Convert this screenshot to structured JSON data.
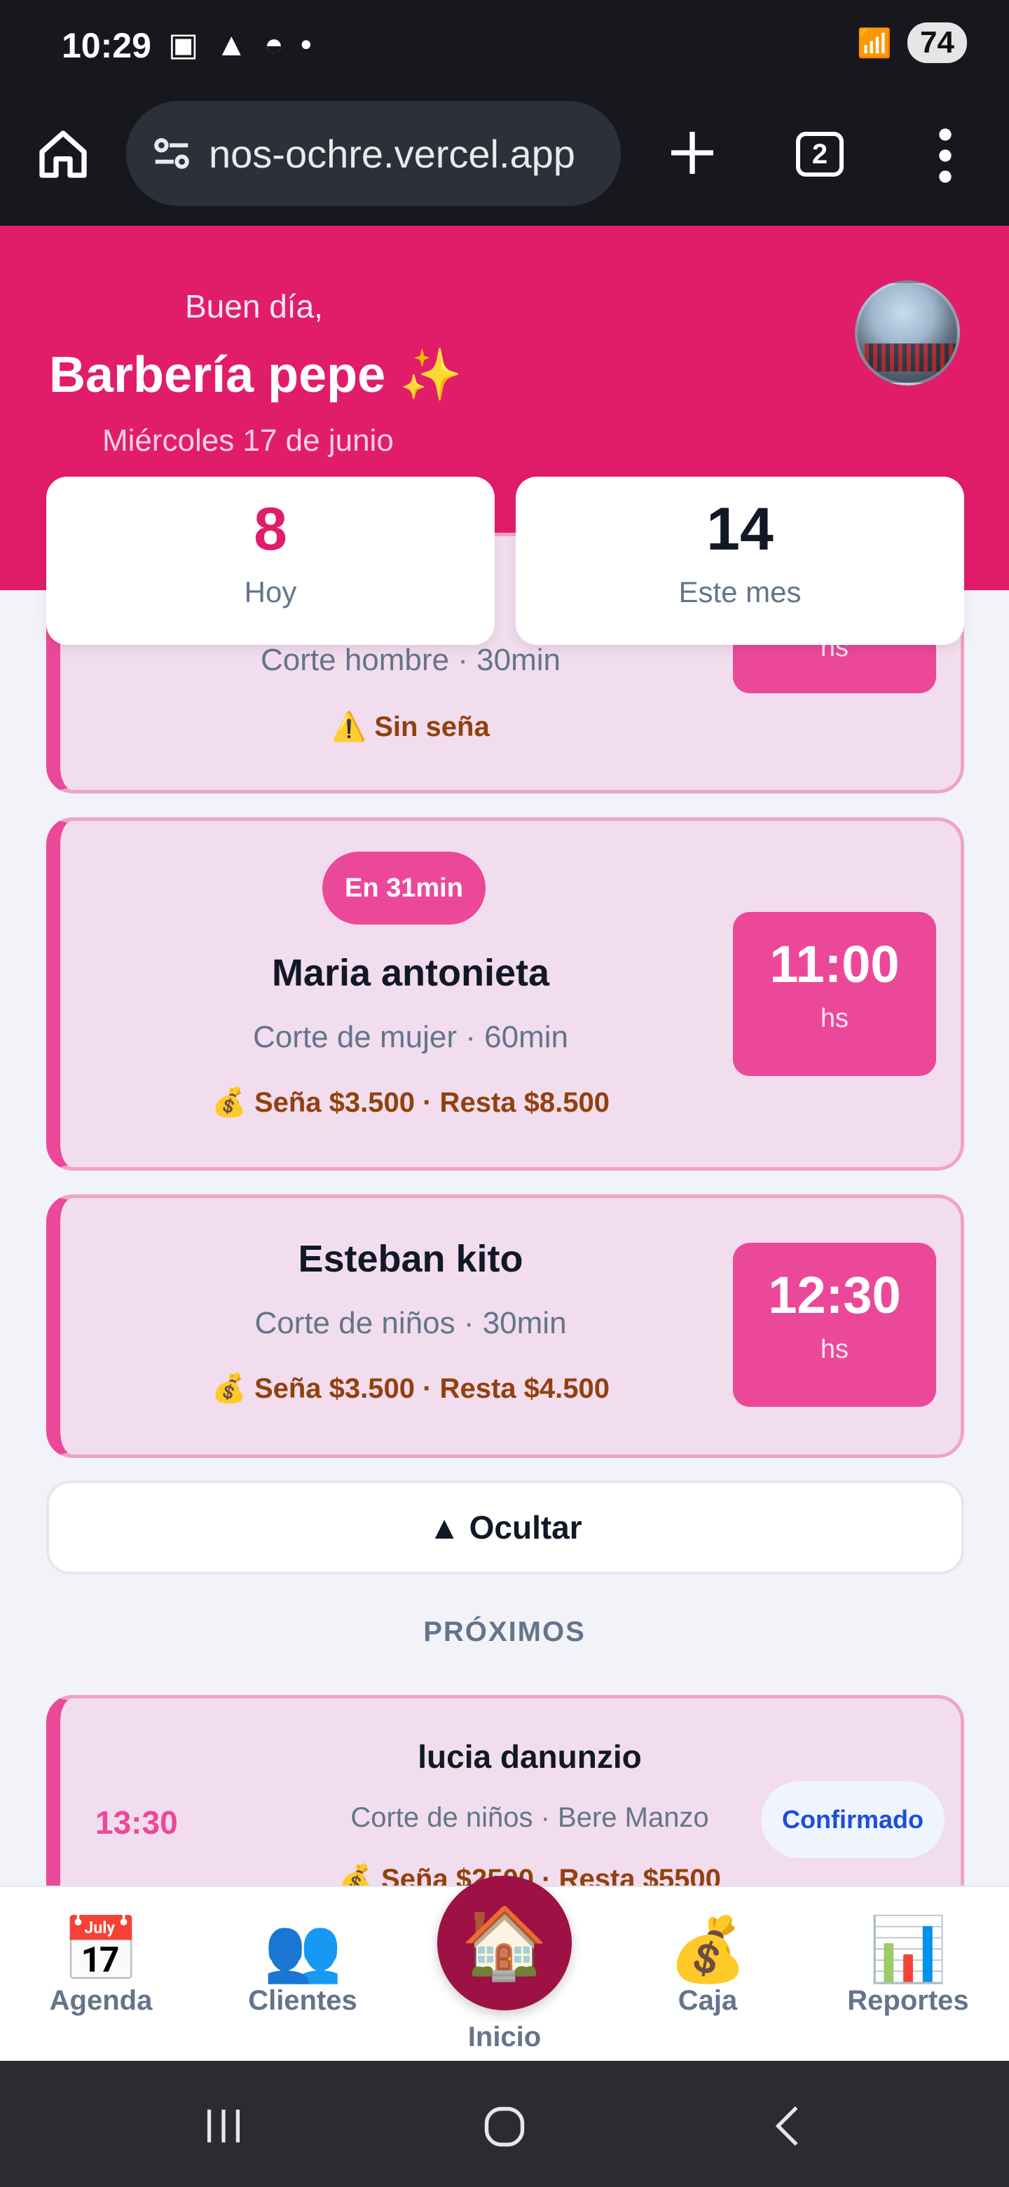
{
  "status_bar": {
    "time": "10:29",
    "battery": "74"
  },
  "browser": {
    "url": "nos-ochre.vercel.app",
    "tab_count": "2"
  },
  "header": {
    "greeting": "Buen día,",
    "shop_name": "Barbería pepe ✨",
    "date": "Miércoles 17 de junio"
  },
  "stats": [
    {
      "value": "8",
      "label": "Hoy"
    },
    {
      "value": "14",
      "label": "Este mes"
    }
  ],
  "appointments": [
    {
      "service": "Corte hombre · 30min",
      "payment": "⚠️ Sin seña",
      "unit": "hs"
    },
    {
      "badge": "En 31min",
      "name": "Maria antonieta",
      "service": "Corte de mujer · 60min",
      "payment": "💰 Seña $3.500 · Resta $8.500",
      "time": "11:00",
      "unit": "hs"
    },
    {
      "name": "Esteban kito",
      "service": "Corte de niños · 30min",
      "payment": "💰 Seña $3.500 · Resta $4.500",
      "time": "12:30",
      "unit": "hs"
    }
  ],
  "hide_button": "▲ Ocultar",
  "upcoming": {
    "title": "PRÓXIMOS",
    "items": [
      {
        "time": "13:30",
        "name": "lucia danunzio",
        "service": "Corte de niños · Bere Manzo",
        "payment": "💰 Seña $2500 · Resta $5500",
        "status": "Confirmado"
      }
    ]
  },
  "nav": {
    "agenda": {
      "label": "Agenda",
      "icon": "📅"
    },
    "clientes": {
      "label": "Clientes",
      "icon": "👥"
    },
    "inicio": {
      "label": "Inicio",
      "icon": "🏠"
    },
    "caja": {
      "label": "Caja",
      "icon": "💰"
    },
    "reportes": {
      "label": "Reportes",
      "icon": "📊"
    }
  },
  "colors": {
    "primary": "#e11d6b",
    "accent": "#ec4899",
    "card_bg": "#f1dded"
  }
}
